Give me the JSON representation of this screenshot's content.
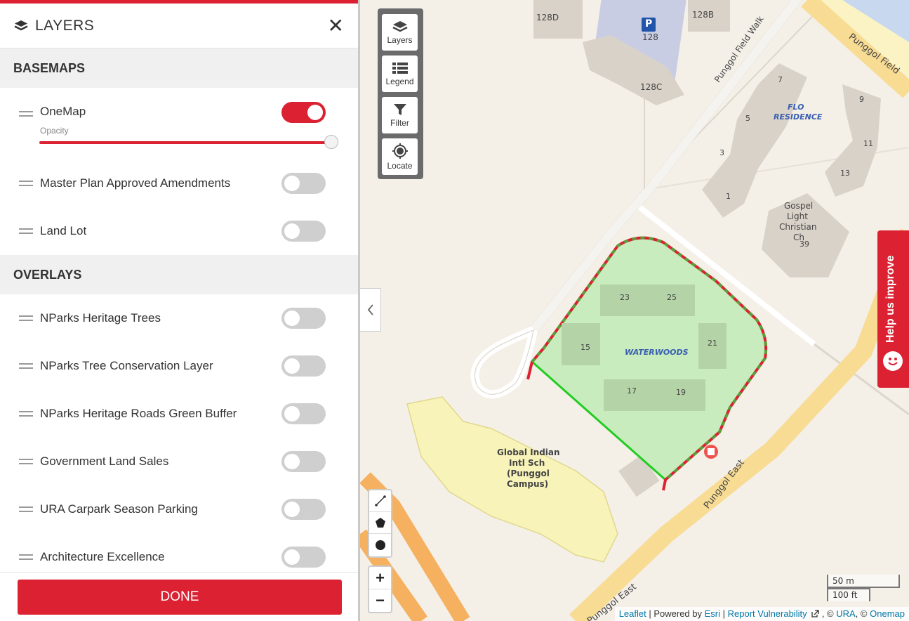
{
  "panel": {
    "title": "LAYERS",
    "close_symbol": "✕",
    "basemaps_heading": "BASEMAPS",
    "overlays_heading": "OVERLAYS",
    "opacity_label": "Opacity",
    "opacity_value": 1.0,
    "basemaps": [
      {
        "label": "OneMap",
        "on": true
      },
      {
        "label": "Master Plan Approved Amendments",
        "on": false
      },
      {
        "label": "Land Lot",
        "on": false
      }
    ],
    "overlays": [
      {
        "label": "NParks Heritage Trees",
        "on": false
      },
      {
        "label": "NParks Tree Conservation Layer",
        "on": false
      },
      {
        "label": "NParks Heritage Roads Green Buffer",
        "on": false
      },
      {
        "label": "Government Land Sales",
        "on": false
      },
      {
        "label": "URA Carpark Season Parking",
        "on": false
      },
      {
        "label": "Architecture Excellence",
        "on": false
      }
    ],
    "done_label": "DONE"
  },
  "tools": {
    "layers": "Layers",
    "legend": "Legend",
    "filter": "Filter",
    "locate": "Locate"
  },
  "zoom": {
    "in": "+",
    "out": "−"
  },
  "help_tab": "Help us improve",
  "scale": {
    "metric": "50 m",
    "imperial": "100 ft"
  },
  "attribution": {
    "leaflet": "Leaflet",
    "powered": " | Powered by ",
    "esri": "Esri",
    "sep": " | ",
    "report": "Report Vulnerability",
    "copy1": " , © ",
    "ura": "URA",
    "copy2": ", © ",
    "onemap": "Onemap"
  },
  "map_labels": {
    "b128d": "128D",
    "b128b": "128B",
    "b128": "128",
    "b128c": "128C",
    "parking": "P",
    "field_walk": "Punggol Field Walk",
    "field": "Punggol Field",
    "flo": "FLO",
    "residence": "RESIDENCE",
    "n7": "7",
    "n5": "5",
    "n3": "3",
    "n1": "1",
    "n9": "9",
    "n11": "11",
    "n13": "13",
    "church1": "Gospel",
    "church2": "Light",
    "church3": "Christian",
    "church4": "Ch",
    "n39": "39",
    "n23": "23",
    "n25": "25",
    "n15": "15",
    "n21": "21",
    "n17": "17",
    "n19": "19",
    "waterwoods": "WATERWOODS",
    "school1": "Global Indian",
    "school2": "Intl Sch",
    "school3": "(Punggol",
    "school4": "Campus)",
    "east1": "Punggol East",
    "east2": "Punggol East"
  },
  "colors": {
    "accent": "#dc2232",
    "polygon_fill": "#c8ecbe",
    "boundary_green": "#22cc22",
    "road": "#f8dc94",
    "orange_road": "#f5b060",
    "building": "#d9d2c9",
    "school_zone": "#f8f3b8"
  }
}
